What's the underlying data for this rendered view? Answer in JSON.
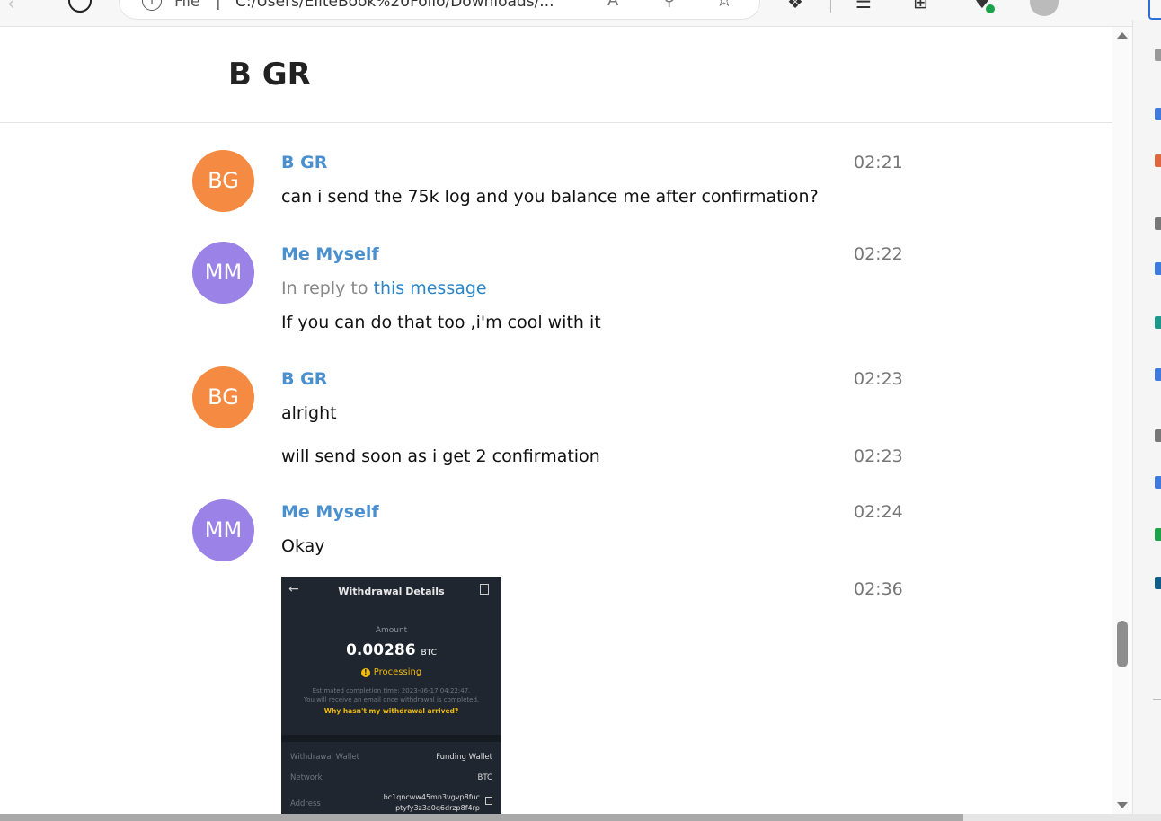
{
  "browser": {
    "address_prefix": "File",
    "separator": "|",
    "url": "C:/Users/EliteBook%20Folio/Downloads/...",
    "icons": [
      "back-arrow-icon",
      "refresh-icon",
      "info-icon",
      "read-aloud-icon",
      "zoom-icon",
      "favorite-star-icon",
      "extensions-icon",
      "favorites-icon",
      "collections-icon",
      "performance-icon",
      "profile-icon",
      "more-icon"
    ]
  },
  "page": {
    "title": "B GR"
  },
  "messages": [
    {
      "avatar": "BG",
      "avatar_color": "#f58a42",
      "sender": "B GR",
      "time": "02:21",
      "lines": [
        "can i send the 75k log and you balance me after confirmation?"
      ]
    },
    {
      "avatar": "MM",
      "avatar_color": "#9b82e6",
      "sender": "Me Myself",
      "time": "02:22",
      "reply_prefix": "In reply to",
      "reply_link": "this message",
      "lines": [
        "If you can do that too ,i'm cool with it"
      ]
    },
    {
      "avatar": "BG",
      "avatar_color": "#f58a42",
      "sender": "B GR",
      "time": "02:23",
      "lines": [
        "alright"
      ]
    },
    {
      "text": "will send soon as i get 2 confirmation",
      "time": "02:23"
    },
    {
      "avatar": "MM",
      "avatar_color": "#9b82e6",
      "sender": "Me Myself",
      "time": "02:24",
      "lines": [
        "Okay"
      ]
    },
    {
      "type": "image",
      "time": "02:36"
    }
  ],
  "attachment": {
    "title": "Withdrawal Details",
    "amount_label": "Amount",
    "amount": "0.00286",
    "amount_unit": "BTC",
    "status": "Processing",
    "note1": "Estimated completion time: 2023-06-17 04:22:47.",
    "note2": "You will receive an email once withdrawal is completed.",
    "link": "Why hasn't my withdrawal arrived?",
    "rows": [
      {
        "label": "Withdrawal Wallet",
        "value": "Funding Wallet"
      },
      {
        "label": "Network",
        "value": "BTC"
      },
      {
        "label": "Address",
        "value": "bc1qncww45mn3vgvp8fuc ptyfy3z3a0q6drzp8f4rp"
      }
    ],
    "address_line1": "bc1qncww45mn3vgvp8fuc",
    "address_line2": "ptyfy3z3a0q6drzp8f4rp"
  },
  "colors": {
    "sender_blue": "#4a90cf",
    "link_blue": "#2a84c6",
    "orange_avatar": "#f58a42",
    "purple_avatar": "#9b82e6",
    "binance_yellow": "#f0b90b"
  }
}
